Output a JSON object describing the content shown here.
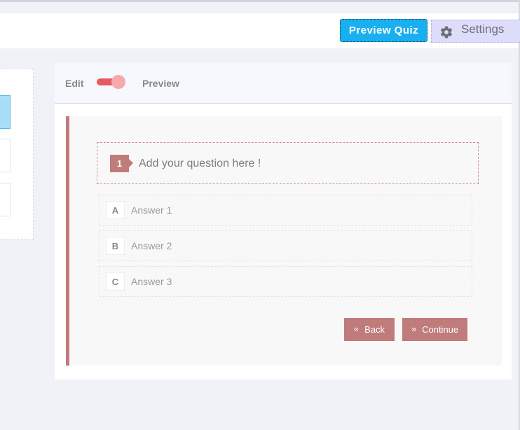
{
  "topbar": {
    "preview_label": "Preview Quiz",
    "settings_label": "Settings",
    "settings_icon": "gear-icon"
  },
  "editor": {
    "edit_label": "Edit",
    "preview_label": "Preview",
    "toggle_state": "on"
  },
  "question": {
    "number": "1",
    "placeholder": "Add your question here !"
  },
  "answers": [
    {
      "letter": "A",
      "text": "Answer 1"
    },
    {
      "letter": "B",
      "text": "Answer 2"
    },
    {
      "letter": "C",
      "text": "Answer 3"
    }
  ],
  "nav": {
    "back_label": "Back",
    "back_icon": "«",
    "continue_label": "Continue",
    "continue_icon": "»"
  },
  "colors": {
    "accent": "#c07b7b",
    "preview_button": "#1ab0f0",
    "toggle_track": "#e55961",
    "settings_bg": "#dcdcfb"
  }
}
